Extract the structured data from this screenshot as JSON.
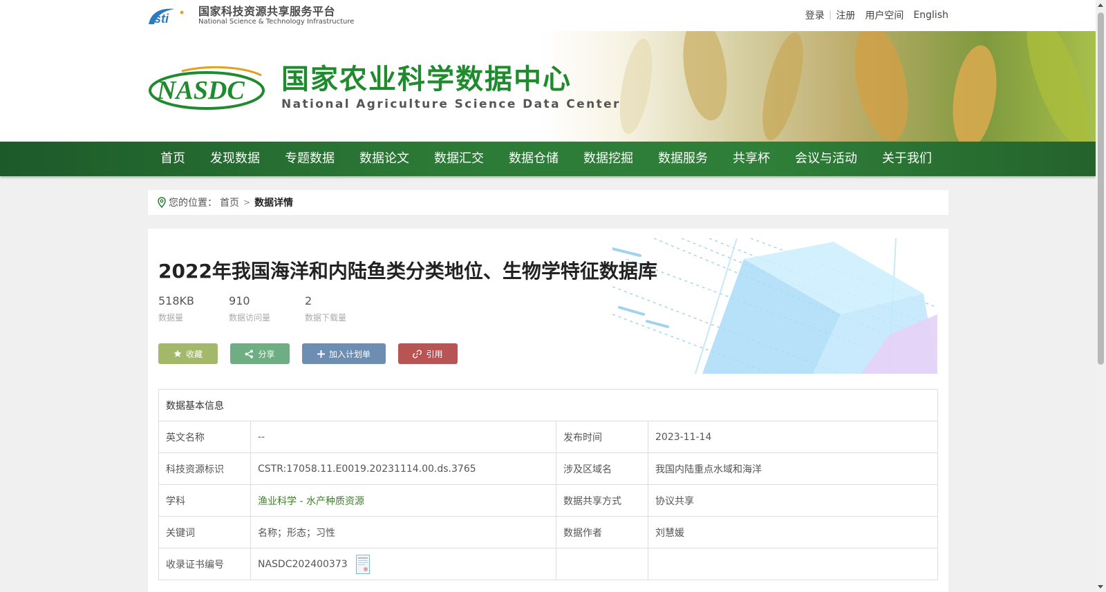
{
  "platform": {
    "name_cn": "国家科技资源共享服务平台",
    "name_en": "National Science & Technology Infrastructure",
    "logo_text": "Nsti"
  },
  "top_links": {
    "login": "登录",
    "register": "注册",
    "user_space": "用户空间",
    "english": "English"
  },
  "center": {
    "logo_text": "NASDC",
    "name_cn": "国家农业科学数据中心",
    "name_en": "National Agriculture Science Data Center"
  },
  "nav": {
    "items": [
      "首页",
      "发现数据",
      "专题数据",
      "数据论文",
      "数据汇交",
      "数据仓储",
      "数据挖掘",
      "数据服务",
      "共享杯",
      "会议与活动",
      "关于我们"
    ]
  },
  "breadcrumb": {
    "prefix": "您的位置：",
    "home": "首页",
    "separator": ">",
    "current": "数据详情"
  },
  "dataset": {
    "title": "2022年我国海洋和内陆鱼类分类地位、生物学特征数据库",
    "stats": [
      {
        "value": "518KB",
        "label": "数据量"
      },
      {
        "value": "910",
        "label": "数据访问量"
      },
      {
        "value": "2",
        "label": "数据下载量"
      }
    ],
    "buttons": {
      "favorite": "收藏",
      "share": "分享",
      "add_plan": "加入计划单",
      "cite": "引用"
    }
  },
  "info_table": {
    "header": "数据基本信息",
    "rows": [
      {
        "k1": "英文名称",
        "v1": "--",
        "k2": "发布时间",
        "v2": "2023-11-14"
      },
      {
        "k1": "科技资源标识",
        "v1": "CSTR:17058.11.E0019.20231114.00.ds.3765",
        "k2": "涉及区域名",
        "v2": "我国内陆重点水域和海洋"
      },
      {
        "k1": "学科",
        "v1": "渔业科学 - 水产种质资源",
        "k2": "数据共享方式",
        "v2": "协议共享"
      },
      {
        "k1": "关键词",
        "v1": "名称；形态；习性",
        "k2": "数据作者",
        "v2": "刘慧媛"
      },
      {
        "k1": "收录证书编号",
        "v1": "NASDC202400373",
        "k2": "",
        "v2": ""
      }
    ]
  },
  "colors": {
    "nav_green": "#2c7a36",
    "title_green": "#1f8a2e",
    "btn_favorite": "#a4b86a",
    "btn_share": "#6fae82",
    "btn_plan": "#6e8db3",
    "btn_cite": "#b85454"
  },
  "icons": {
    "breadcrumb": "location-pin-icon",
    "favorite": "star-icon",
    "share": "share-icon",
    "add_plan": "plus-icon",
    "cite": "link-icon",
    "certificate": "certificate-icon"
  }
}
